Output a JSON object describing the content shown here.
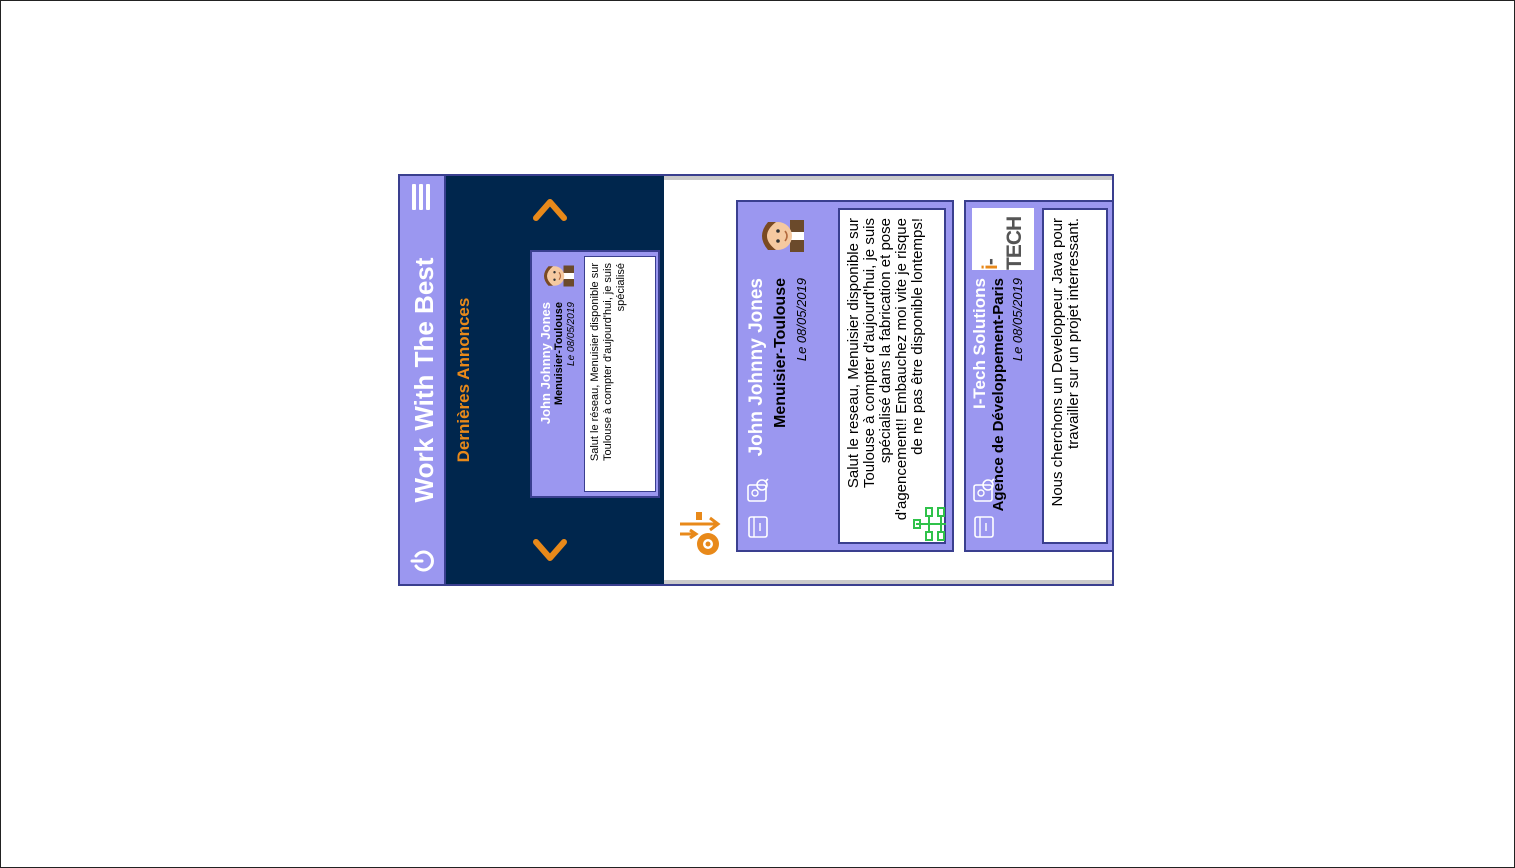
{
  "app": {
    "title": "Work With The Best"
  },
  "recent": {
    "title": "Dernières Annonces",
    "card": {
      "name": "John Johnny Jones",
      "job": "Menuisier-Toulouse",
      "date": "Le 08/05/2019",
      "text": "Salut le réseau, Menuisier disponible sur Toulouse à compter d'aujourd'hui, je suis spécialisé"
    }
  },
  "feed": {
    "posts": [
      {
        "name": "John Johnny Jones",
        "job": "Menuisier-Toulouse",
        "date": "Le 08/05/2019",
        "text": "Salut le reseau, Menuisier disponible sur Toulouse à compter d'aujourd'hui, je suis spécialisé dans la fabrication et pose d'agencement!! Embauchez moi vite je risque de ne pas être disponible lontemps!"
      },
      {
        "name": "I-Tech Solutions",
        "job": "Agence de Développement-Paris",
        "date": "Le 08/05/2019",
        "logo": "I-TECH",
        "text": "Nous cherchons un Developpeur Java pour travailler sur un projet interressant."
      }
    ]
  },
  "colors": {
    "header": "#9b97f0",
    "dark": "#00264d",
    "accent": "#e8891a",
    "border": "#3a3f8f"
  },
  "icons": [
    "menu-icon",
    "power-icon",
    "chevron-up-icon",
    "chevron-down-icon",
    "filter-icon",
    "contact-icon",
    "calendar-icon",
    "tree-icon"
  ]
}
